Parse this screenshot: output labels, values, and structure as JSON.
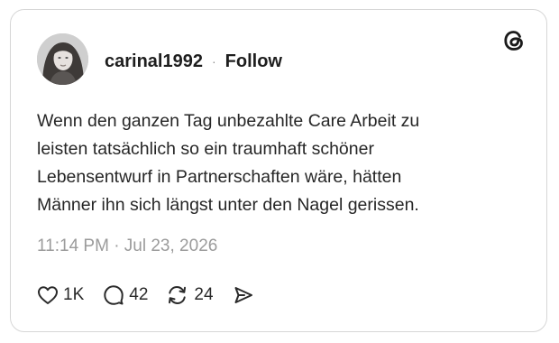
{
  "post": {
    "username": "carinal1992",
    "separator": "·",
    "follow_label": "Follow",
    "text": "Wenn den ganzen Tag unbezahlte Care Arbeit zu\nleisten tatsächlich so ein traumhaft schöner\nLebensentwurf in Partnerschaften wäre, hätten\nMänner ihn sich längst unter den Nagel gerissen.",
    "timestamp": "11:14 PM · Jul 23, 2026"
  },
  "actions": {
    "likes": "1K",
    "replies": "42",
    "reposts": "24"
  },
  "icons": {
    "brand": "threads-logo-icon",
    "like": "heart-icon",
    "reply": "speech-bubble-icon",
    "repost": "repost-arrows-icon",
    "share": "send-arrow-icon"
  },
  "colors": {
    "text": "#262626",
    "muted": "#9b9b9b",
    "border": "#d6d6d6",
    "background": "#ffffff"
  }
}
